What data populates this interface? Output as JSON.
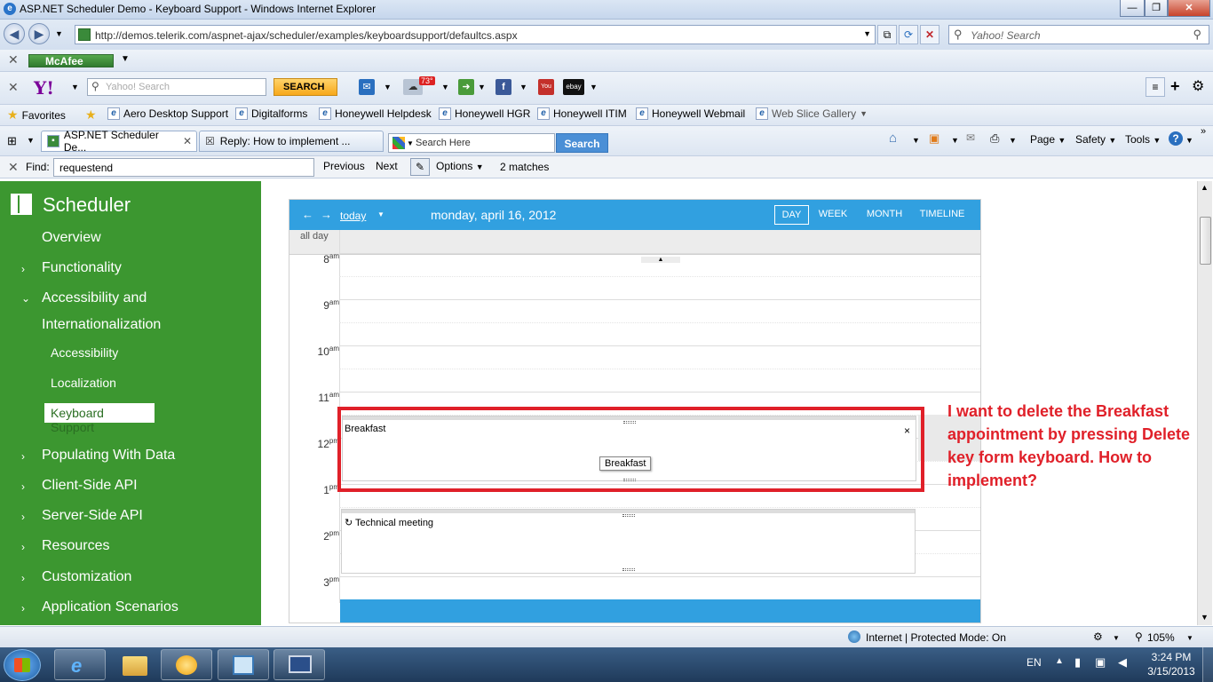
{
  "window": {
    "title": "ASP.NET Scheduler Demo - Keyboard Support - Windows Internet Explorer"
  },
  "address": {
    "url": "http://demos.telerik.com/aspnet-ajax/scheduler/examples/keyboardsupport/defaultcs.aspx",
    "search_placeholder": "Yahoo! Search"
  },
  "toolbar_mcafee": {
    "label": "McAfee"
  },
  "toolbar_yahoo": {
    "logo": "Y!",
    "search_placeholder": "Yahoo! Search",
    "search_button": "SEARCH",
    "weather_temp": "73°"
  },
  "favorites": {
    "label": "Favorites",
    "items": [
      "Aero Desktop Support",
      "Digitalforms",
      "Honeywell Helpdesk",
      "Honeywell HGR",
      "Honeywell ITIM",
      "Honeywell Webmail",
      "Web Slice Gallery"
    ]
  },
  "tabs": [
    {
      "label": "ASP.NET Scheduler De..."
    },
    {
      "label": "Reply: How to implement ..."
    }
  ],
  "bing": {
    "placeholder": "Search Here",
    "button": "Search"
  },
  "commandbar": {
    "page": "Page",
    "safety": "Safety",
    "tools": "Tools"
  },
  "findbar": {
    "label": "Find:",
    "value": "requestend",
    "previous": "Previous",
    "next": "Next",
    "options": "Options",
    "matches": "2 matches"
  },
  "sidebar": {
    "title": "Scheduler",
    "items": [
      {
        "label": "Overview"
      },
      {
        "label": "Functionality"
      },
      {
        "label": "Accessibility and"
      },
      {
        "label": "Internationalization"
      },
      {
        "label": "Accessibility"
      },
      {
        "label": "Localization"
      },
      {
        "label": "Keyboard Support"
      },
      {
        "label": "Populating With Data"
      },
      {
        "label": "Client-Side API"
      },
      {
        "label": "Server-Side API"
      },
      {
        "label": "Resources"
      },
      {
        "label": "Customization"
      },
      {
        "label": "Application Scenarios"
      }
    ]
  },
  "scheduler": {
    "today": "today",
    "date": "monday, april 16, 2012",
    "views": [
      "DAY",
      "WEEK",
      "MONTH",
      "TIMELINE"
    ],
    "selected_view": "DAY",
    "allday": "all day",
    "hours": [
      {
        "h": "8",
        "ampm": "am"
      },
      {
        "h": "9",
        "ampm": "am"
      },
      {
        "h": "10",
        "ampm": "am"
      },
      {
        "h": "11",
        "ampm": "am"
      },
      {
        "h": "12",
        "ampm": "pm"
      },
      {
        "h": "1",
        "ampm": "pm"
      },
      {
        "h": "2",
        "ampm": "pm"
      },
      {
        "h": "3",
        "ampm": "pm"
      }
    ],
    "appointments": [
      {
        "title": "Breakfast",
        "tooltip": "Breakfast",
        "delete": "×"
      },
      {
        "title": "Technical meeting"
      }
    ]
  },
  "annotation": "I want to delete the Breakfast appointment by pressing Delete key form  keyboard. How to implement?",
  "statusbar": {
    "zone": "Internet | Protected Mode: On",
    "zoom": "105%"
  },
  "taskbar": {
    "lang": "EN",
    "time": "3:24 PM",
    "date": "3/15/2013"
  },
  "colors": {
    "sidebar": "#3c9730",
    "scheduler_header": "#31a0e0",
    "annotation_red": "#e02029"
  }
}
